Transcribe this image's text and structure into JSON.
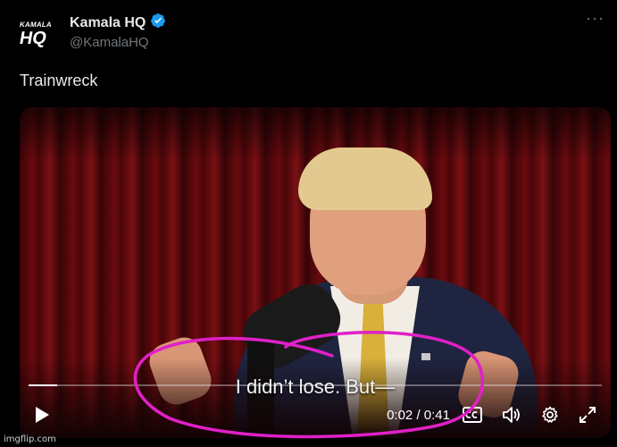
{
  "author": {
    "display_name": "Kamala HQ",
    "handle": "@KamalaHQ",
    "avatar_small_text": "KAMALA",
    "avatar_big_text": "HQ",
    "verified_color": "#1d9bf0"
  },
  "more_icon": "more-horizontal-icon",
  "tweet": {
    "text": "Trainwreck"
  },
  "video": {
    "caption": "I didn’t lose. But—",
    "time_current": "0:02",
    "time_separator": "/",
    "time_total": "0:41",
    "progress_fraction": 0.05,
    "controls": [
      "play-icon",
      "captions-icon",
      "volume-icon",
      "settings-icon",
      "fullscreen-icon"
    ]
  },
  "annotation": {
    "color": "#e020c8"
  },
  "watermark": "imgflip.com"
}
